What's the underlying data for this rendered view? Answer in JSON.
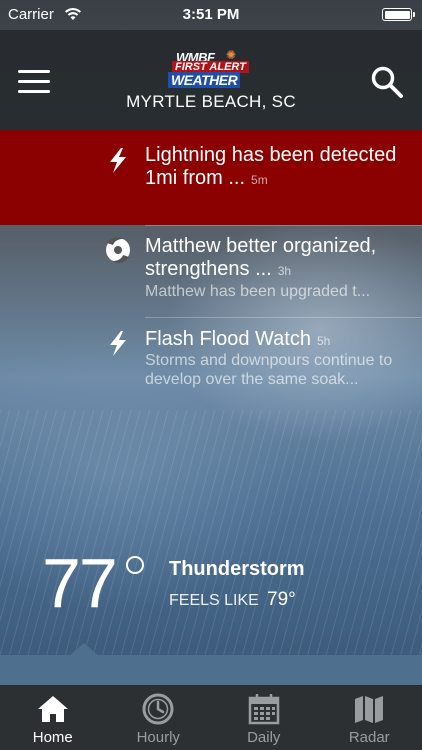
{
  "status_bar": {
    "carrier": "Carrier",
    "time": "3:51 PM"
  },
  "header": {
    "logo": {
      "line1": "WMBF",
      "line2": "FIRST ALERT",
      "line3": "WEATHER"
    },
    "location": "MYRTLE BEACH, SC",
    "menu_icon": "hamburger-icon",
    "search_icon": "search-icon"
  },
  "alerts": [
    {
      "icon": "lightning-icon",
      "title": "Lightning has been detected 1mi from ...",
      "age": "5m",
      "summary": "",
      "highlight_color": "#8b0000"
    },
    {
      "icon": "hurricane-icon",
      "title": "Matthew better organized, strengthens ...",
      "age": "3h",
      "summary": "Matthew has been upgraded t..."
    },
    {
      "icon": "lightning-icon",
      "title": "Flash Flood Watch",
      "age": "5h",
      "summary": "Storms and downpours continue to develop over the same soak..."
    }
  ],
  "current": {
    "temperature": "77",
    "condition": "Thunderstorm",
    "feels_like_label": "FEELS LIKE",
    "feels_like_value": "79°"
  },
  "tabs": [
    {
      "label": "Home",
      "icon": "home-icon",
      "active": true
    },
    {
      "label": "Hourly",
      "icon": "clock-icon",
      "active": false
    },
    {
      "label": "Daily",
      "icon": "calendar-icon",
      "active": false
    },
    {
      "label": "Radar",
      "icon": "map-icon",
      "active": false
    }
  ]
}
